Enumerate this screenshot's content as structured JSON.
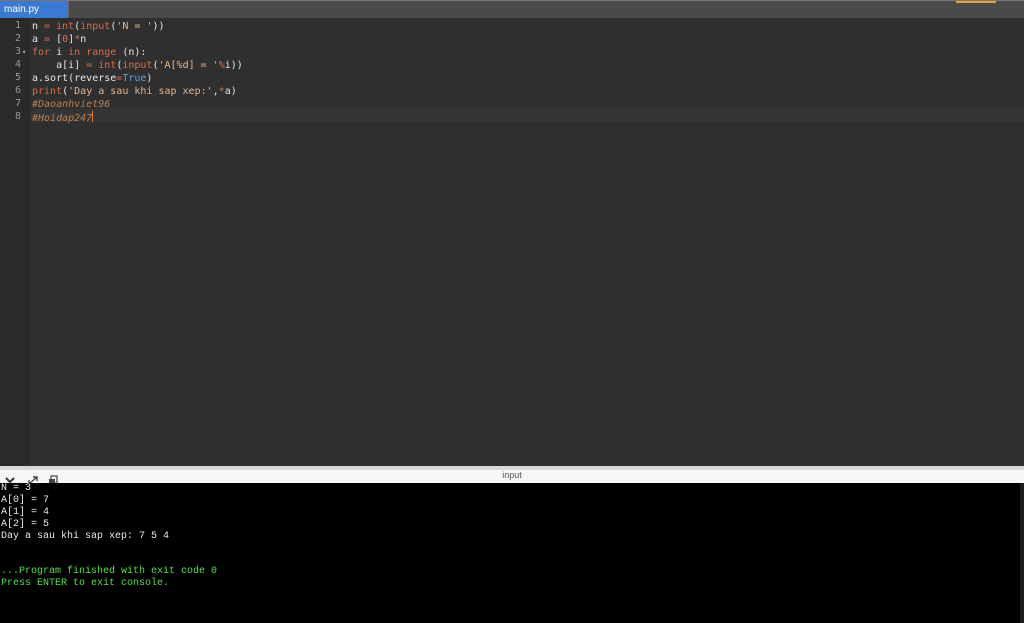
{
  "tab": {
    "label": "main.py"
  },
  "colors": {
    "accent": "#e8a13a",
    "tab": "#3b7ad0",
    "keyword": "#d96b4c",
    "string": "#e2b78f",
    "comment": "#b97f52",
    "bool": "#5ea2e0",
    "console_green": "#55e04a"
  },
  "editor": {
    "line_numbers": [
      "1",
      "2",
      "3",
      "4",
      "5",
      "6",
      "7",
      "8"
    ],
    "lines": [
      [
        {
          "t": "n ",
          "c": ""
        },
        {
          "t": "=",
          "c": "op"
        },
        {
          "t": " ",
          "c": ""
        },
        {
          "t": "int",
          "c": "bi"
        },
        {
          "t": "(",
          "c": ""
        },
        {
          "t": "input",
          "c": "bi"
        },
        {
          "t": "(",
          "c": ""
        },
        {
          "t": "'N = '",
          "c": "str"
        },
        {
          "t": "))",
          "c": ""
        }
      ],
      [
        {
          "t": "a ",
          "c": ""
        },
        {
          "t": "=",
          "c": "op"
        },
        {
          "t": " [",
          "c": ""
        },
        {
          "t": "0",
          "c": "num"
        },
        {
          "t": "]",
          "c": ""
        },
        {
          "t": "*",
          "c": "op"
        },
        {
          "t": "n",
          "c": ""
        }
      ],
      [
        {
          "t": "for",
          "c": "kw"
        },
        {
          "t": " i ",
          "c": ""
        },
        {
          "t": "in",
          "c": "kw"
        },
        {
          "t": " ",
          "c": ""
        },
        {
          "t": "range",
          "c": "bi"
        },
        {
          "t": " (n):",
          "c": ""
        }
      ],
      [
        {
          "t": "    a[i] ",
          "c": ""
        },
        {
          "t": "=",
          "c": "op"
        },
        {
          "t": " ",
          "c": ""
        },
        {
          "t": "int",
          "c": "bi"
        },
        {
          "t": "(",
          "c": ""
        },
        {
          "t": "input",
          "c": "bi"
        },
        {
          "t": "(",
          "c": ""
        },
        {
          "t": "'A[%d] = '",
          "c": "str"
        },
        {
          "t": "%",
          "c": "op"
        },
        {
          "t": "i))",
          "c": ""
        }
      ],
      [
        {
          "t": "a.sort(reverse",
          "c": ""
        },
        {
          "t": "=",
          "c": "op"
        },
        {
          "t": "True",
          "c": "bool"
        },
        {
          "t": ")",
          "c": ""
        }
      ],
      [
        {
          "t": "print",
          "c": "bi"
        },
        {
          "t": "(",
          "c": ""
        },
        {
          "t": "'Day a sau khi sap xep:'",
          "c": "str"
        },
        {
          "t": ",",
          "c": ""
        },
        {
          "t": "*",
          "c": "op"
        },
        {
          "t": "a)",
          "c": ""
        }
      ],
      [
        {
          "t": "#Daoanhviet96",
          "c": "com"
        }
      ],
      [
        {
          "t": "#Hoidap247",
          "c": "com"
        }
      ]
    ],
    "fold_line_index": 2
  },
  "console": {
    "title": "input",
    "icons": [
      "chevron-down-icon",
      "expand-icon",
      "copy-icon"
    ],
    "output_lines": [
      "N = 3",
      "A[0] = 7",
      "A[1] = 4",
      "A[2] = 5",
      "Day a sau khi sap xep: 7 5 4"
    ],
    "status_lines": [
      "...Program finished with exit code 0",
      "Press ENTER to exit console."
    ]
  }
}
